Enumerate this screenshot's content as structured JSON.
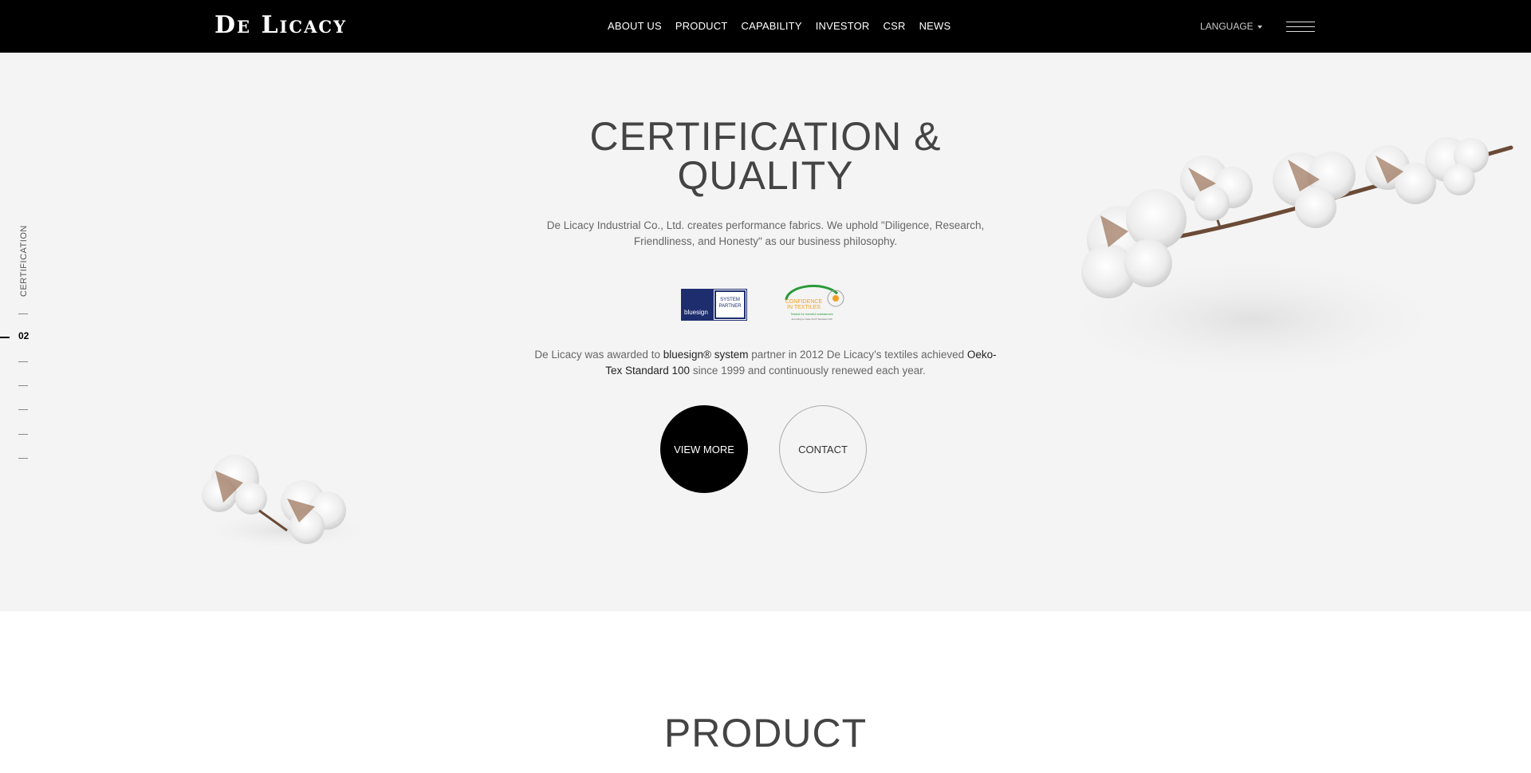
{
  "header": {
    "logo_main": "De Licacy",
    "nav": [
      {
        "label": "ABOUT US"
      },
      {
        "label": "PRODUCT"
      },
      {
        "label": "CAPABILITY"
      },
      {
        "label": "INVESTOR"
      },
      {
        "label": "CSR"
      },
      {
        "label": "NEWS"
      }
    ],
    "language_label": "LANGUAGE"
  },
  "side": {
    "section_label": "CERTIFICATION",
    "active_index": "02"
  },
  "hero": {
    "title_line1": "CERTIFICATION &",
    "title_line2": "QUALITY",
    "description": "De Licacy Industrial Co., Ltd. creates performance fabrics. We uphold \"Diligence, Research, Friendliness, and Honesty\" as our business philosophy.",
    "award_prefix": "De Licacy was awarded to ",
    "award_hl1": "bluesign® system",
    "award_mid": " partner in 2012 De Licacy’s textiles achieved ",
    "award_hl2": "Oeko-Tex Standard 100",
    "award_suffix": " since 1999 and continuously renewed each year.",
    "logo_bluesign": {
      "left": "bluesign",
      "right": "SYSTEM PARTNER"
    },
    "logo_oeko": {
      "line1": "CONFIDENCE",
      "line2": "IN TEXTILES",
      "line3": "Tested for harmful substances",
      "line4": "according to Oeko-Tex® Standard 100"
    },
    "btn_view_more": "VIEW MORE",
    "btn_contact": "CONTACT"
  },
  "product": {
    "title": "PRODUCT"
  },
  "colors": {
    "header_bg": "#000000",
    "hero_bg": "#f4f4f4",
    "bluesign_blue": "#1d2d6e",
    "oeko_green": "#2a9a3a",
    "oeko_orange": "#f0a020"
  }
}
